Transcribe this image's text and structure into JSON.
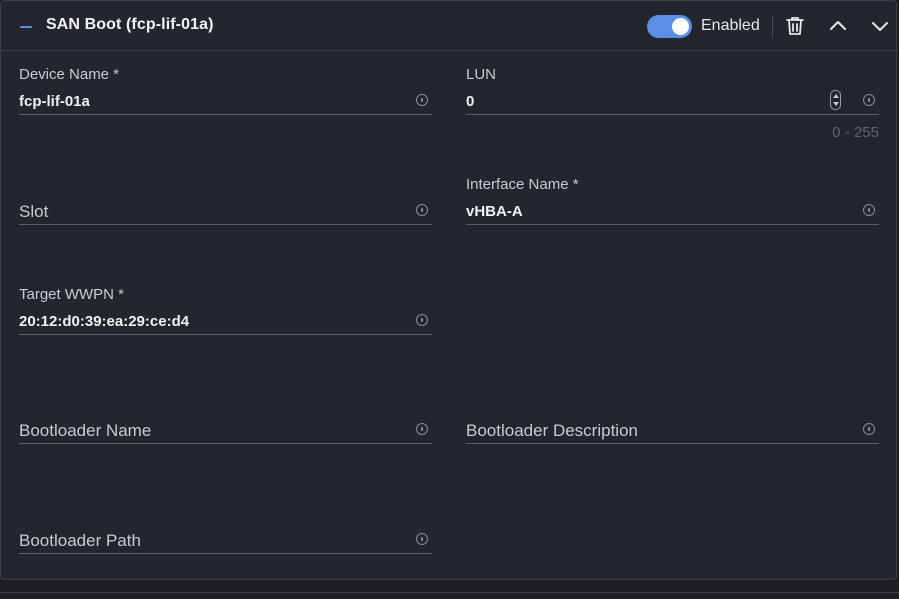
{
  "header": {
    "title": "SAN Boot (fcp-lif-01a)",
    "toggle_label": "Enabled",
    "toggle_on": true,
    "icons": [
      "collapse-icon",
      "trash-icon",
      "chevron-up-icon",
      "chevron-down-icon"
    ]
  },
  "fields": {
    "device_name": {
      "label": "Device Name *",
      "value": "fcp-lif-01a"
    },
    "lun": {
      "label": "LUN",
      "value": "0",
      "range_hint": "0 - 255"
    },
    "slot": {
      "placeholder": "Slot"
    },
    "interface_name": {
      "label": "Interface Name *",
      "value": "vHBA-A"
    },
    "target_wwpn": {
      "label": "Target WWPN *",
      "value": "20:12:d0:39:ea:29:ce:d4"
    },
    "bootloader_name": {
      "placeholder": "Bootloader Name"
    },
    "bootloader_description": {
      "placeholder": "Bootloader Description"
    },
    "bootloader_path": {
      "placeholder": "Bootloader Path"
    }
  },
  "colors": {
    "accent": "#5b8ee6",
    "panel_bg": "#23262c",
    "border": "#3a3e46"
  }
}
